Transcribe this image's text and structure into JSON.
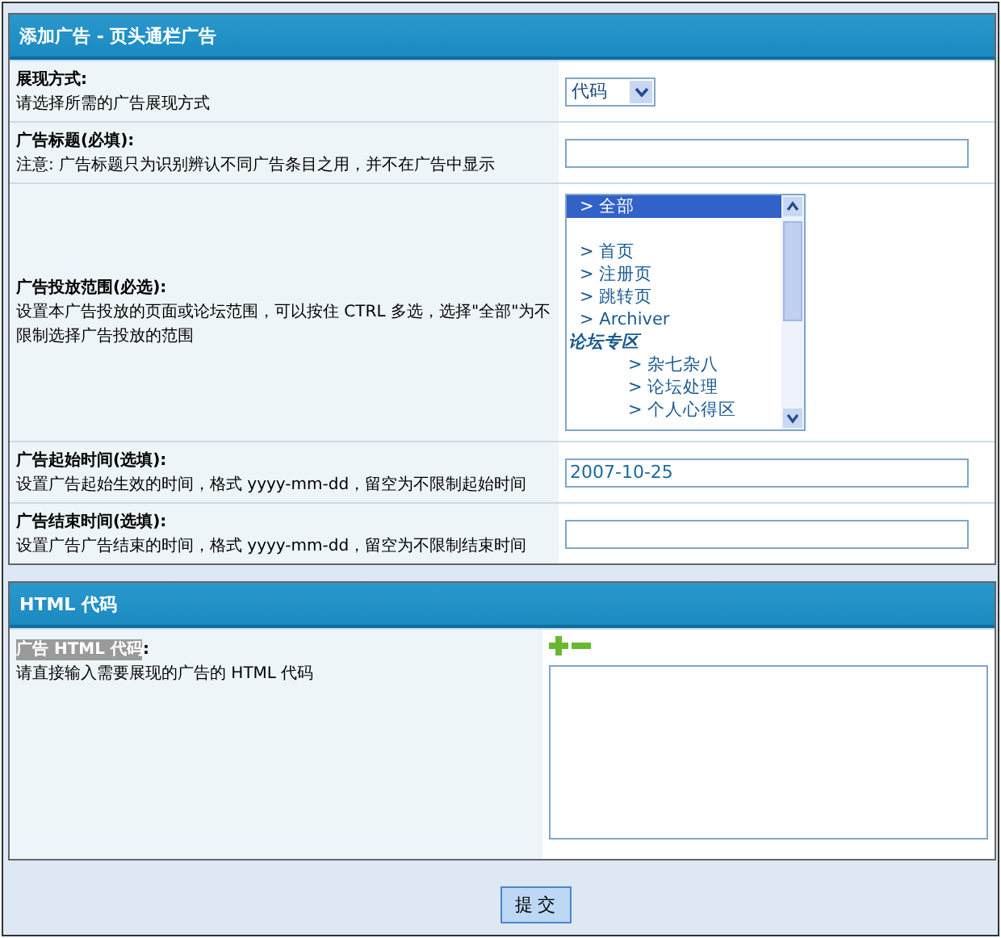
{
  "sections": [
    {
      "title": "添加广告 - 页头通栏广告",
      "rows": [
        {
          "kind": "select",
          "label": "展现方式:",
          "hint": "请选择所需的广告展现方式",
          "value": "代码"
        },
        {
          "kind": "text",
          "label": "广告标题(必填):",
          "hint": "注意: 广告标题只为识别辨认不同广告条目之用，并不在广告中显示",
          "value": ""
        },
        {
          "kind": "list",
          "label": "广告投放范围(必选):",
          "hint": "设置本广告投放的页面或论坛范围，可以按住 CTRL 多选，选择\"全部\"为不限制选择广告投放的范围",
          "options": [
            {
              "kind": "option",
              "label": "> 全部",
              "selected": true
            },
            {
              "kind": "blank"
            },
            {
              "kind": "option",
              "label": "> 首页",
              "selected": false
            },
            {
              "kind": "option",
              "label": "> 注册页",
              "selected": false
            },
            {
              "kind": "option",
              "label": "> 跳转页",
              "selected": false
            },
            {
              "kind": "option",
              "label": "> Archiver",
              "selected": false
            },
            {
              "kind": "group",
              "label": "论坛专区",
              "children": [
                {
                  "kind": "option",
                  "label": "> 杂七杂八",
                  "selected": false
                },
                {
                  "kind": "option",
                  "label": "> 论坛处理",
                  "selected": false
                },
                {
                  "kind": "option",
                  "label": "> 个人心得区",
                  "selected": false
                }
              ]
            }
          ]
        },
        {
          "kind": "text",
          "label": "广告起始时间(选填):",
          "hint": "设置广告起始生效的时间，格式 yyyy-mm-dd，留空为不限制起始时间",
          "value": "2007-10-25"
        },
        {
          "kind": "text",
          "label": "广告结束时间(选填):",
          "hint": "设置广告广告结束的时间，格式 yyyy-mm-dd，留空为不限制结束时间",
          "value": ""
        }
      ]
    },
    {
      "title": "HTML 代码",
      "rows": [
        {
          "kind": "textarea",
          "label": "广告 HTML 代码",
          "label_suffix": ":",
          "highlighted": true,
          "hint": "请直接输入需要展现的广告的 HTML 代码",
          "value": ""
        }
      ]
    }
  ],
  "submit": "提 交"
}
